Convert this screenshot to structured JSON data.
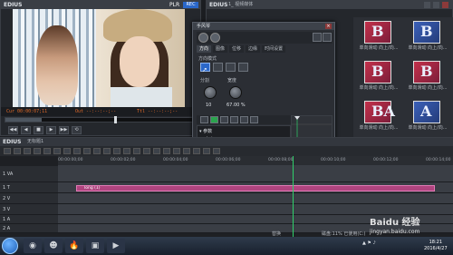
{
  "player": {
    "brand": "EDIUS",
    "mode": "PLR",
    "rec": "REC",
    "tc_in": "Cur 00:00:07;11",
    "tc_out": "Out --:--:--;--",
    "tc_len": "Ttl --:--:--;--",
    "transport": [
      "◀◀",
      "◀",
      "■",
      "▶",
      "▶▶",
      "⟲"
    ]
  },
  "bin": {
    "brand": "EDIUS",
    "title": "1_ 视频媒体",
    "thumbs": [
      {
        "glyph": "B",
        "caption": "单向滑动 向上/向...",
        "color": "red"
      },
      {
        "glyph": "B",
        "caption": "单向滑动 向上/向...",
        "color": "blue"
      },
      {
        "glyph": "B",
        "caption": "单向滑动 向上/向...",
        "color": "red"
      },
      {
        "glyph": "B",
        "caption": "单向滑动 向上/向...",
        "color": "red"
      },
      {
        "glyph": "BA",
        "caption": "单向滑动 向上/向...",
        "color": "red"
      },
      {
        "glyph": "A",
        "caption": "单向滑动 向上/向...",
        "color": "blue"
      }
    ]
  },
  "dialog": {
    "title": "手风琴",
    "tabs": [
      "方向",
      "图像",
      "位移",
      "边缘",
      "时间设置"
    ],
    "direction_label": "方向模式",
    "segments_label": "分割",
    "segments_value": "10",
    "stretch_label": "宽度",
    "stretch_value": "67.00 %",
    "kf_rows": [
      {
        "label": "▾ 参数",
        "value": ""
      },
      {
        "label": "☑ 宽度",
        "value": "67.00"
      }
    ],
    "graph_values": [
      "100.0",
      "100",
      "0.00"
    ],
    "timecode": "Cur 00:00:00;16  Ttl 00:00:00;16",
    "ok": "确定",
    "cancel": "取消"
  },
  "timeline": {
    "brand": "EDIUS",
    "name": "无标题1",
    "ruler": [
      "00:00:00;00",
      "00:00:02;00",
      "00:00:04;00",
      "00:00:06;00",
      "00:00:08;00",
      "00:00:10;00",
      "00:00:12;00",
      "00:00:14;00"
    ],
    "tracks": [
      {
        "name": "1 VA",
        "kind": "va"
      },
      {
        "name": "1 T",
        "kind": "t"
      },
      {
        "name": "2 V",
        "kind": "v"
      },
      {
        "name": "3 V",
        "kind": "v"
      },
      {
        "name": "1 A",
        "kind": "a"
      },
      {
        "name": "2 A",
        "kind": "a"
      }
    ],
    "clip_label": "long (1)",
    "status": "替换",
    "status2": "磁盘:11% 已使用(C:)"
  },
  "taskbar": {
    "apps": [
      "◉",
      "☻",
      "🔥",
      "▣",
      "▶"
    ],
    "time": "18:21",
    "date": "2016/4/27"
  },
  "watermark": {
    "line1": "Baidu 经验",
    "line2": "jingyan.baidu.com"
  }
}
